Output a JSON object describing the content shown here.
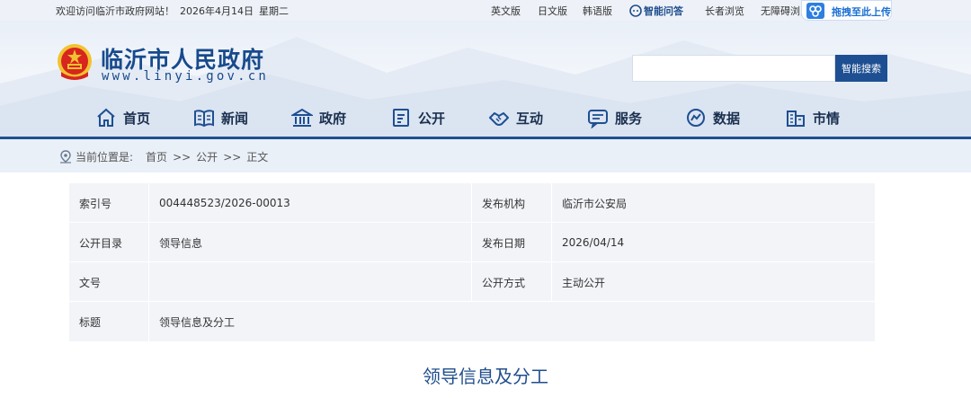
{
  "topbar": {
    "welcome": "欢迎访问临沂市政府网站！",
    "date": "2026年4月14日",
    "weekday": "星期二",
    "links": {
      "english": "英文版",
      "japanese": "日文版",
      "korean": "韩语版",
      "ai_qa": "智能问答",
      "elderly": "长者浏览",
      "accessible": "无障碍浏览"
    },
    "upload": "拖拽至此上传"
  },
  "header": {
    "title": "临沂市人民政府",
    "url": "www.linyi.gov.cn",
    "search": {
      "value": "",
      "placeholder": "",
      "button": "智能搜索"
    }
  },
  "nav": [
    {
      "label": "首页",
      "icon": "home-icon"
    },
    {
      "label": "新闻",
      "icon": "news-icon"
    },
    {
      "label": "政府",
      "icon": "government-icon"
    },
    {
      "label": "公开",
      "icon": "disclosure-icon"
    },
    {
      "label": "互动",
      "icon": "handshake-icon"
    },
    {
      "label": "服务",
      "icon": "service-icon"
    },
    {
      "label": "数据",
      "icon": "data-icon"
    },
    {
      "label": "市情",
      "icon": "city-icon"
    }
  ],
  "breadcrumb": {
    "prefix": "当前位置是:",
    "items": [
      "首页",
      "公开",
      "正文"
    ],
    "separator": ">>"
  },
  "meta": {
    "index_label": "索引号",
    "index_value": "004448523/2026-00013",
    "publisher_label": "发布机构",
    "publisher_value": "临沂市公安局",
    "catalog_label": "公开目录",
    "catalog_value": "领导信息",
    "date_label": "发布日期",
    "date_value": "2026/04/14",
    "docno_label": "文号",
    "docno_value": "",
    "method_label": "公开方式",
    "method_value": "主动公开",
    "subject_label": "标题",
    "subject_value": "领导信息及分工"
  },
  "article": {
    "title": "领导信息及分工"
  },
  "colors": {
    "brand_blue": "#1e4f92",
    "title_blue": "#174a8c",
    "link_blue": "#1b6fd3",
    "emblem_red": "#d7261e",
    "emblem_gold": "#f2c230"
  }
}
